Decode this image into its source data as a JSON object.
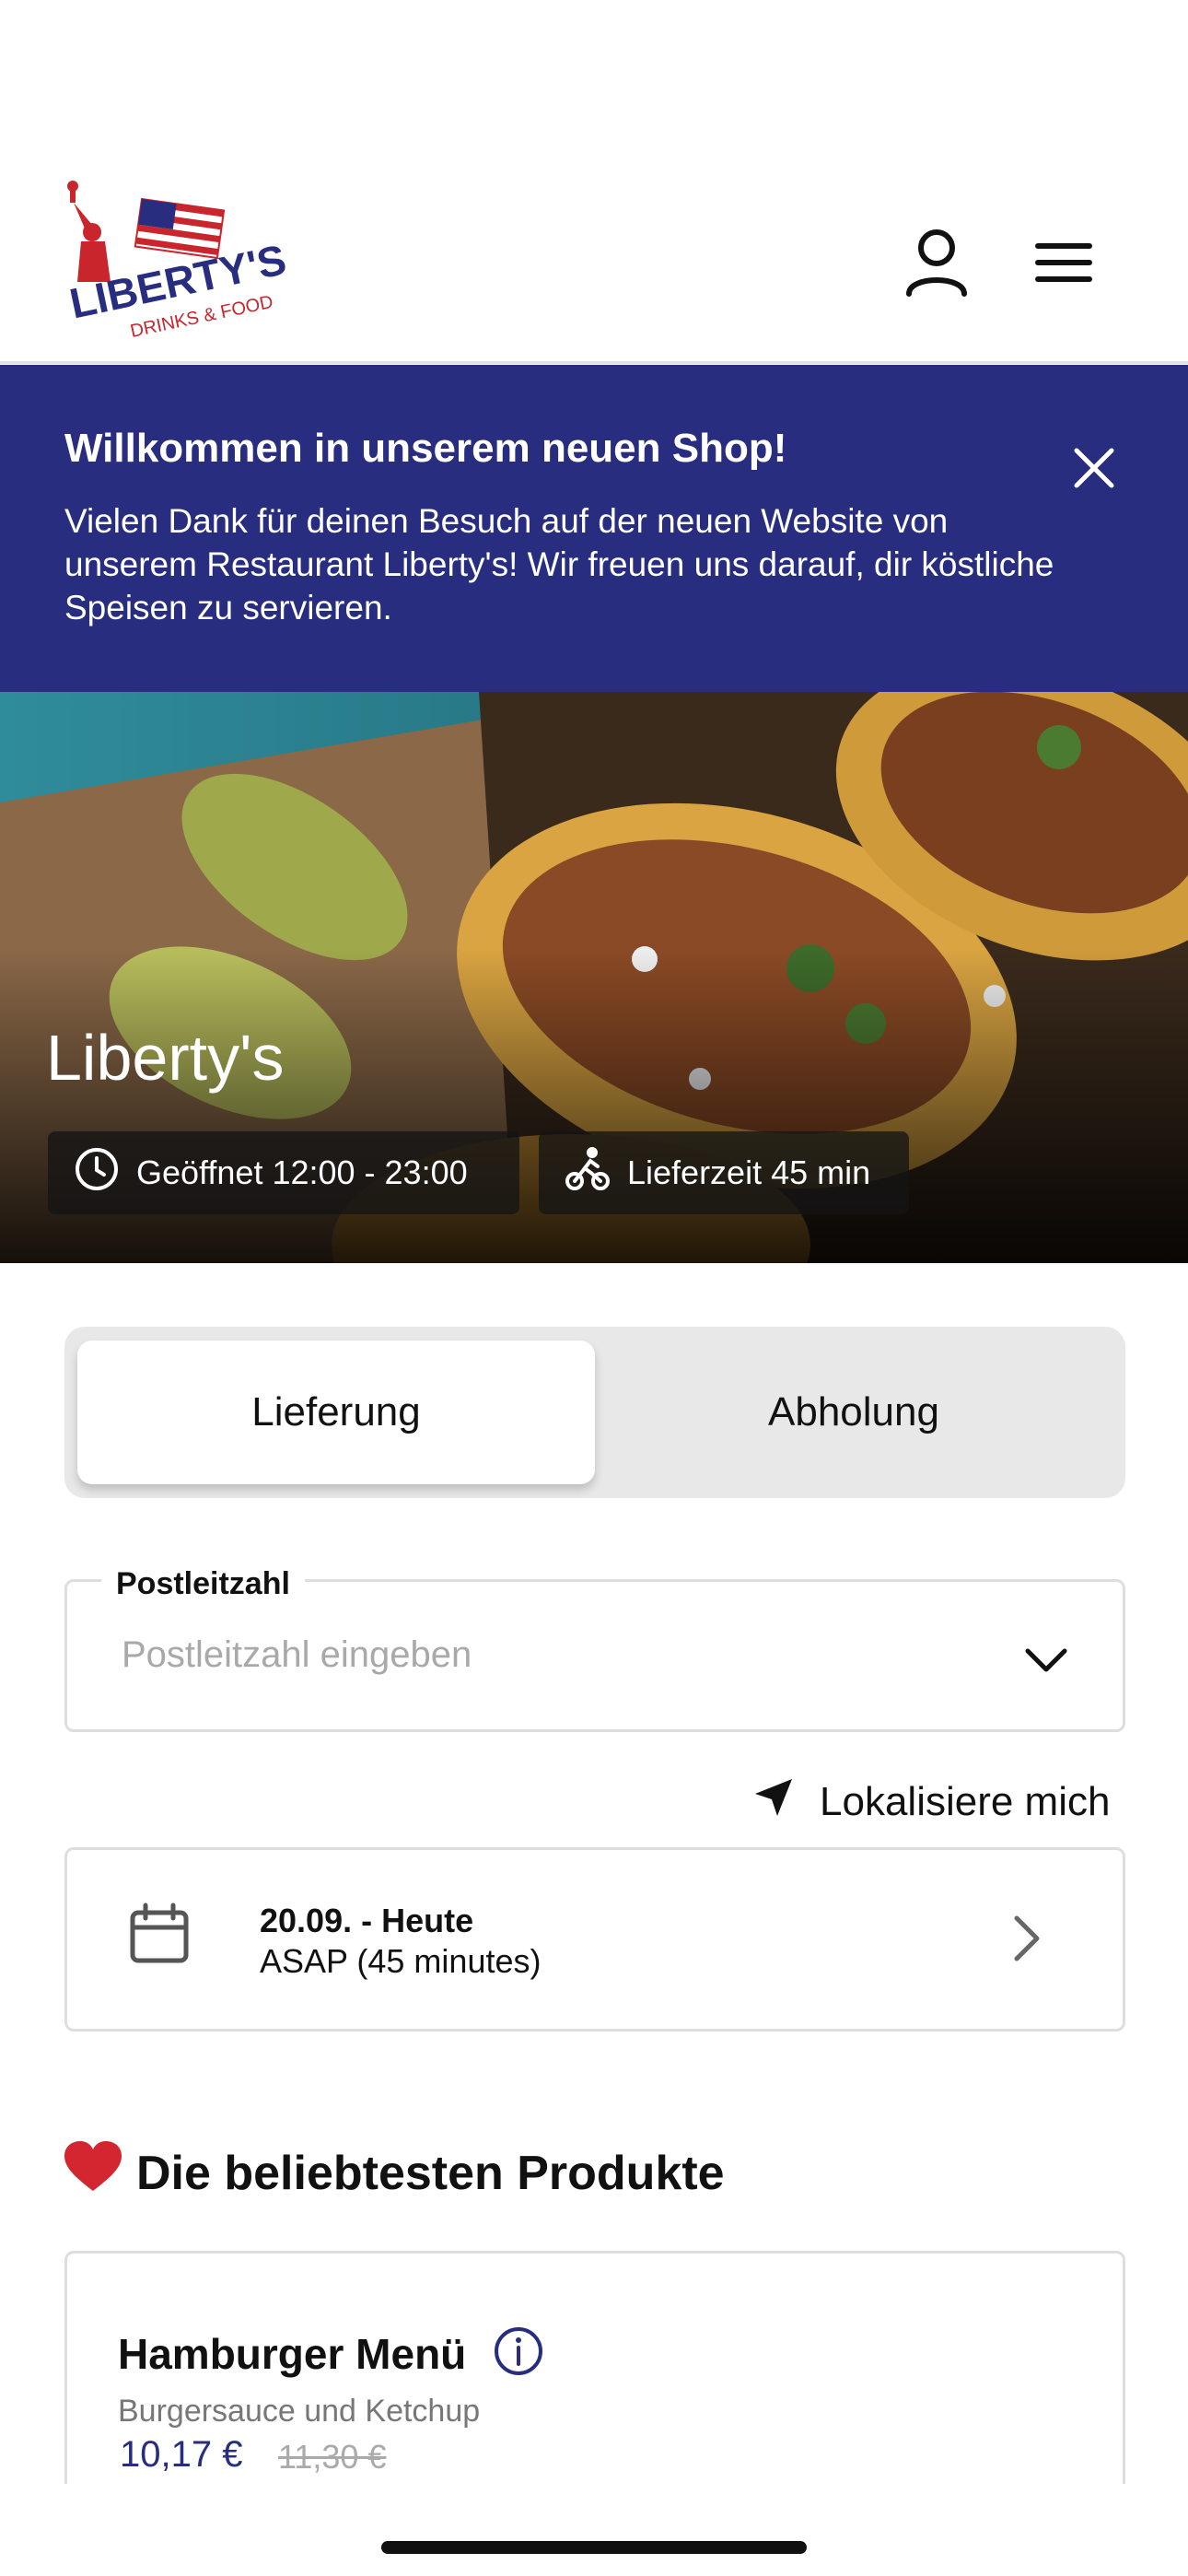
{
  "header": {
    "logo_text_main": "LIBERTY'S",
    "logo_text_sub": "DRINKS & FOOD",
    "icons": [
      "user-icon",
      "hamburger-menu-icon"
    ]
  },
  "banner": {
    "title": "Willkommen in unserem neuen Shop!",
    "text": "Vielen Dank für deinen Besuch auf der neuen Website von unserem Restaurant Liberty's! Wir freuen uns darauf, dir köstliche Speisen zu servieren."
  },
  "hero": {
    "restaurant_name": "Liberty's",
    "opening_hours": "Geöffnet 12:00 - 23:00",
    "delivery_time": "Lieferzeit 45 min"
  },
  "order_type": {
    "options": [
      "Lieferung",
      "Abholung"
    ],
    "selected": "Lieferung"
  },
  "postcode": {
    "label": "Postleitzahl",
    "placeholder": "Postleitzahl eingeben",
    "value": ""
  },
  "locate_me": "Lokalisiere mich",
  "schedule": {
    "date": "20.09. - Heute",
    "time": "ASAP (45 minutes)"
  },
  "popular": {
    "title": "Die beliebtesten Produkte",
    "items": [
      {
        "name": "Hamburger Menü",
        "description": "Burgersauce und Ketchup",
        "price": "10,17 €",
        "old_price": "11,30 €"
      }
    ]
  },
  "colors": {
    "brand": "#282d7f",
    "accent_red": "#d22630"
  }
}
